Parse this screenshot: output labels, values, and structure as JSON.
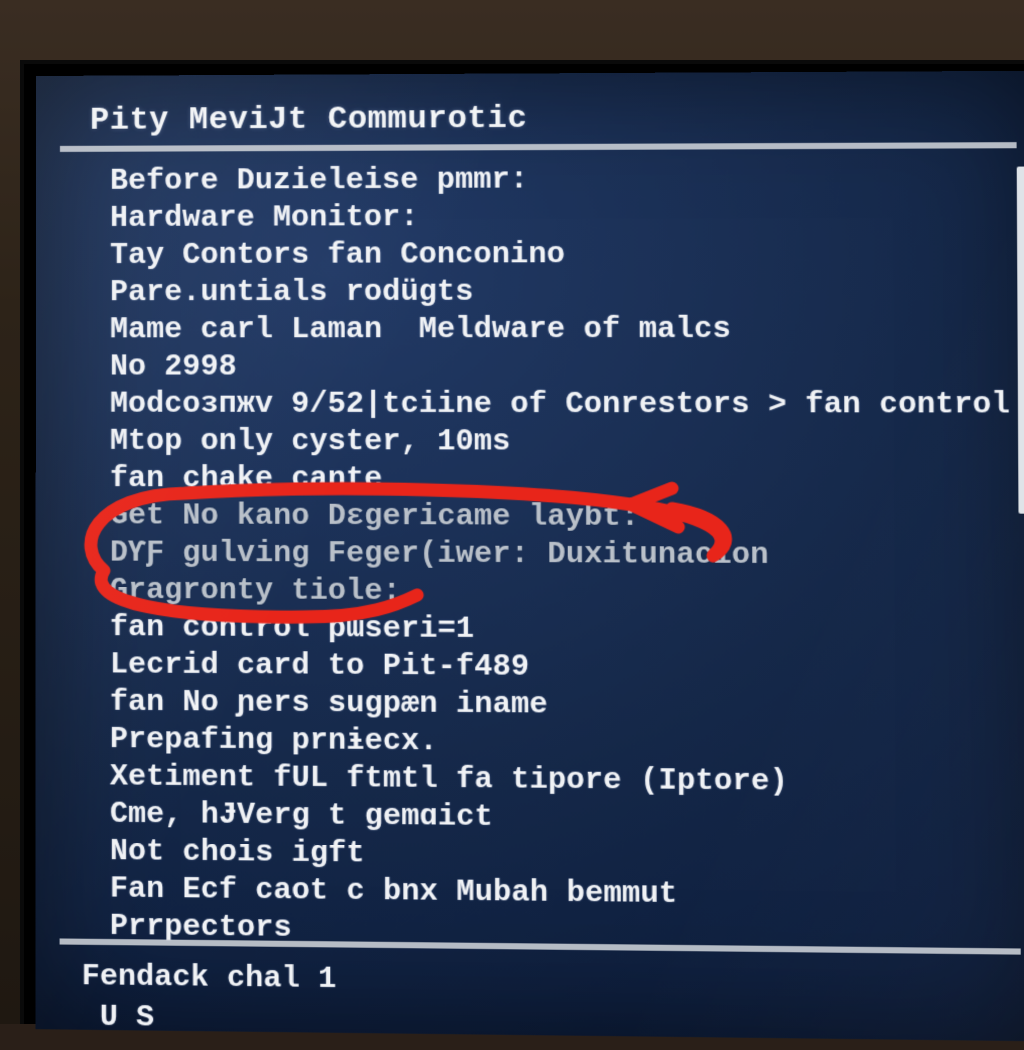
{
  "title": "Pity MeviJt Commurotic",
  "lines": [
    "Before Duzieleise pmmr:",
    "Hardware Monitor:",
    "Tay Contors fan Conconino",
    "Pare.untials rodügts",
    "Mame carl Laman  Meldware of malcs",
    "No 2998",
    "Modcoɜпжv 9/52|tciine of Conrestors > fan control",
    "Mtop only cyster, 10ms",
    "fan chake cante",
    "Get No kano Dɛgericame laybt:",
    "DƳƑ gulving Feger(iwer: Duxitunacion",
    "Gragronty tiole:",
    "fan control pɯseri=1",
    "Lecrid card to Pit-f489",
    "fan No ɲers sugpæn iname",
    "Prepafing prnɨecx.",
    "Xetiment fUL ftmtl fa tipore (Iptore)",
    "Cme, hɈVerg t gemɑict",
    "Not chois igft",
    "Fan Ecf caot c bnx Mubah bemmut",
    "Prrpectors"
  ],
  "footer": {
    "line1": "Fendack chal 1",
    "line2": " U S"
  },
  "annotation_color": "#e8251a"
}
